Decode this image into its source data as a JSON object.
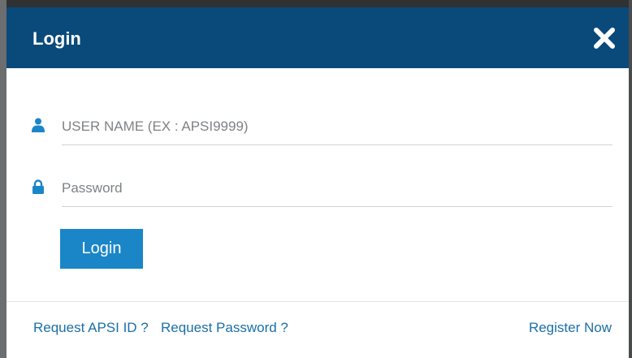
{
  "dialog": {
    "title": "Login",
    "close_icon": "close-icon"
  },
  "form": {
    "username": {
      "placeholder": "USER NAME (EX : APSI9999)",
      "value": "",
      "icon": "user-icon"
    },
    "password": {
      "placeholder": "Password",
      "value": "",
      "icon": "lock-icon"
    },
    "submit_label": "Login"
  },
  "footer": {
    "request_id_label": "Request APSI ID ?",
    "request_password_label": "Request Password ?",
    "register_label": "Register Now"
  },
  "colors": {
    "header_bg": "#0a4a7a",
    "button_bg": "#1a86c8",
    "link": "#1a6fa8",
    "icon": "#1a86c8"
  }
}
